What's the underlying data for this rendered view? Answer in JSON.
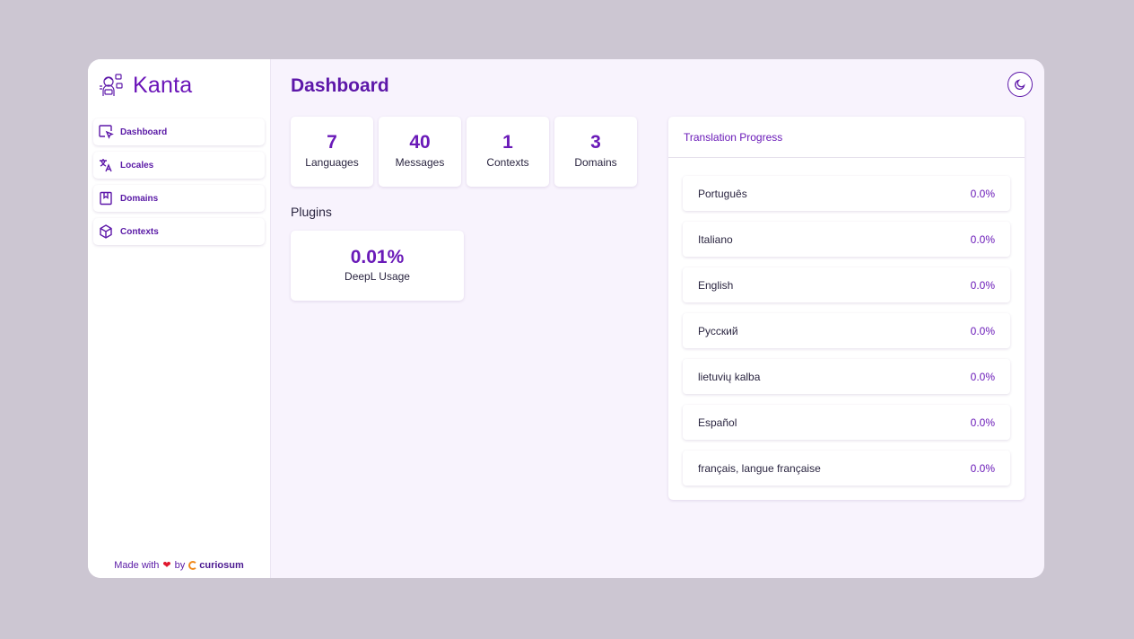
{
  "brand": {
    "name": "Kanta"
  },
  "sidebar": {
    "items": [
      {
        "label": "Dashboard",
        "icon": "cursor-select-icon"
      },
      {
        "label": "Locales",
        "icon": "translate-icon"
      },
      {
        "label": "Domains",
        "icon": "bookmark-box-icon"
      },
      {
        "label": "Contexts",
        "icon": "cube-icon"
      }
    ],
    "footer": {
      "made_with": "Made with",
      "by": "by",
      "company": "curiosum",
      "heart": "❤"
    }
  },
  "header": {
    "title": "Dashboard",
    "theme_toggle_icon": "moon-icon"
  },
  "stats": [
    {
      "value": "7",
      "label": "Languages"
    },
    {
      "value": "40",
      "label": "Messages"
    },
    {
      "value": "1",
      "label": "Contexts"
    },
    {
      "value": "3",
      "label": "Domains"
    }
  ],
  "plugins": {
    "title": "Plugins",
    "items": [
      {
        "value": "0.01%",
        "label": "DeepL Usage"
      }
    ]
  },
  "translation_progress": {
    "title": "Translation Progress",
    "rows": [
      {
        "name": "Português",
        "percent": "0.0%"
      },
      {
        "name": "Italiano",
        "percent": "0.0%"
      },
      {
        "name": "English",
        "percent": "0.0%"
      },
      {
        "name": "Русский",
        "percent": "0.0%"
      },
      {
        "name": "lietuvių kalba",
        "percent": "0.0%"
      },
      {
        "name": "Español",
        "percent": "0.0%"
      },
      {
        "name": "français, langue française",
        "percent": "0.0%"
      }
    ]
  },
  "colors": {
    "accent": "#6a1ab8",
    "background": "#ccc6d2",
    "panel": "#f8f3fd",
    "heart": "#e0182d",
    "brand_mark": "#f08a1c"
  }
}
